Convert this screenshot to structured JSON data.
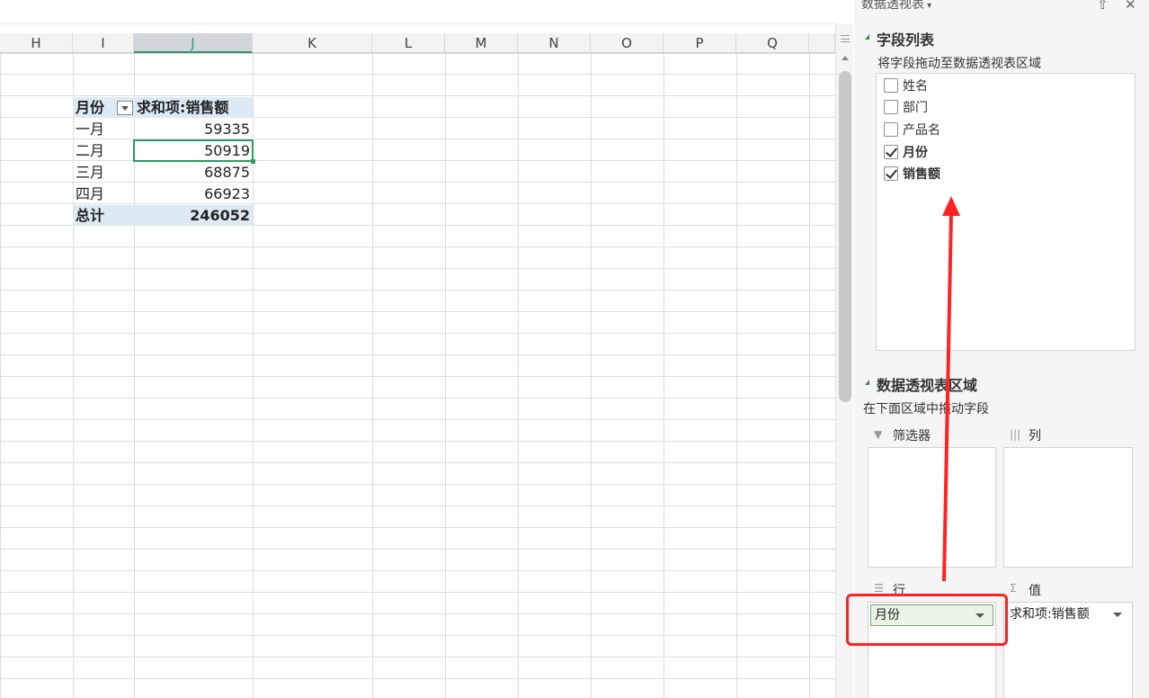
{
  "spreadsheet": {
    "columns": [
      "H",
      "I",
      "J",
      "K",
      "L",
      "M",
      "N",
      "O",
      "P",
      "Q"
    ],
    "selected_column": "J",
    "pivot": {
      "header_month": "月份",
      "header_sum": "求和项:销售额",
      "rows": [
        {
          "month": "一月",
          "value": "59335"
        },
        {
          "month": "二月",
          "value": "50919"
        },
        {
          "month": "三月",
          "value": "68875"
        },
        {
          "month": "四月",
          "value": "66923"
        }
      ],
      "total_label": "总计",
      "total_value": "246052"
    }
  },
  "pane": {
    "title": "数据透视表",
    "field_list": {
      "title": "字段列表",
      "hint": "将字段拖动至数据透视表区域",
      "fields": [
        {
          "label": "姓名",
          "checked": false
        },
        {
          "label": "部门",
          "checked": false
        },
        {
          "label": "产品名",
          "checked": false
        },
        {
          "label": "月份",
          "checked": true
        },
        {
          "label": "销售额",
          "checked": true
        }
      ]
    },
    "areas": {
      "title": "数据透视表区域",
      "hint": "在下面区域中拖动字段",
      "filter_label": "筛选器",
      "column_label": "列",
      "row_label": "行",
      "value_label": "值",
      "row_chip": "月份",
      "value_chip": "求和项:销售额"
    }
  },
  "colors": {
    "annotation": "#ff2222",
    "selection": "#2e9a62",
    "pivot_header_fill": "#dde9f5"
  }
}
